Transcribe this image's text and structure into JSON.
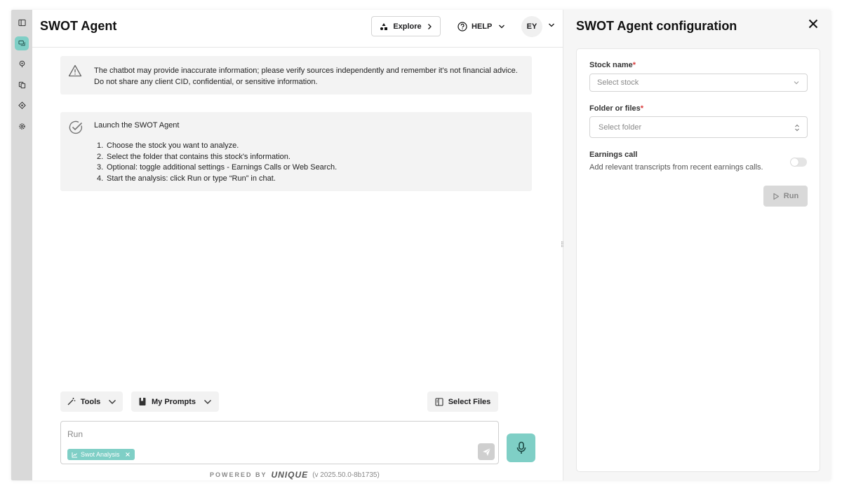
{
  "colors": {
    "accent": "#7fcfc6",
    "rail": "#d9d9d9",
    "notice_bg": "#f3f3f3",
    "required": "#d93a3a"
  },
  "rail": {
    "items": [
      {
        "icon": "sidebar-toggle-icon",
        "active": false
      },
      {
        "icon": "chat-icon",
        "active": true
      },
      {
        "icon": "explore-icon",
        "active": false
      },
      {
        "icon": "documents-icon",
        "active": false
      },
      {
        "icon": "prompts-icon",
        "active": false
      },
      {
        "icon": "settings-icon",
        "active": false
      }
    ]
  },
  "header": {
    "title": "SWOT Agent",
    "explore_label": "Explore",
    "help_label": "HELP",
    "user_initials": "EY"
  },
  "notice": {
    "line1": "The chatbot may provide inaccurate information; please verify sources independently and remember it's not financial advice.",
    "line2": "Do not share any client CID, confidential, or sensitive information."
  },
  "launch": {
    "title": "Launch the SWOT Agent",
    "steps": [
      {
        "n": "1.",
        "text": "Choose the stock you want to analyze."
      },
      {
        "n": "2.",
        "text": "Select the folder that contains this stock's information."
      },
      {
        "n": "3.",
        "text": "Optional: toggle additional settings - Earnings Calls or Web Search."
      },
      {
        "n": "4.",
        "text": "Start the analysis: click Run or type “Run” in chat."
      }
    ]
  },
  "toolbar": {
    "tools_label": "Tools",
    "prompts_label": "My Prompts",
    "select_files_label": "Select Files"
  },
  "composer": {
    "value": "Run",
    "chip_label": "Swot Analysis"
  },
  "footer": {
    "powered_by": "POWERED BY",
    "brand": "UNIQUE",
    "version": "(v 2025.50.0-8b1735)"
  },
  "config": {
    "title": "SWOT Agent configuration",
    "stock_label": "Stock name",
    "stock_placeholder": "Select stock",
    "folder_label": "Folder or files",
    "folder_placeholder": "Select folder",
    "earnings_label": "Earnings call",
    "earnings_desc": "Add relevant transcripts from recent earnings calls.",
    "earnings_enabled": false,
    "run_label": "Run",
    "required_mark": "*"
  }
}
